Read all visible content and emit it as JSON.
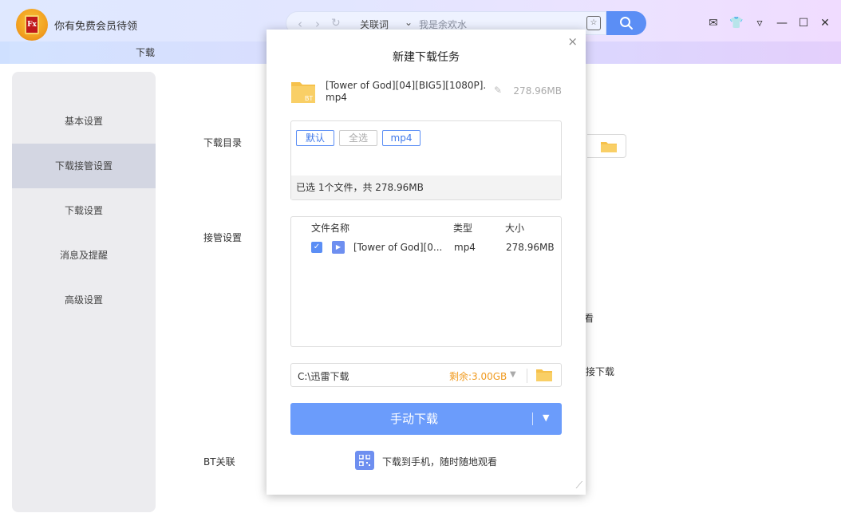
{
  "app": {
    "vip_text": "你有免费会员待领",
    "logo_text": "Fx",
    "tab_label": "下载"
  },
  "search": {
    "assoc_label": "关联词",
    "placeholder": "我是余欢水"
  },
  "sidebar": {
    "items": [
      {
        "label": "基本设置"
      },
      {
        "label": "下载接管设置"
      },
      {
        "label": "下载设置"
      },
      {
        "label": "消息及提醒"
      },
      {
        "label": "高级设置"
      }
    ]
  },
  "settings": {
    "download_dir_label": "下载目录",
    "takeover_label": "接管设置",
    "bt_label": "BT关联",
    "frag_1": "看",
    "frag_2": "接下载"
  },
  "dialog": {
    "title": "新建下载任务",
    "file_name": "[Tower of God][04][BIG5][1080P].mp4",
    "file_size": "278.96MB",
    "bt_badge": "BT",
    "filters": [
      {
        "label": "默认",
        "active": true
      },
      {
        "label": "全选",
        "active": false
      },
      {
        "label": "mp4",
        "active": true
      }
    ],
    "selection_summary": "已选 1个文件，共 278.96MB",
    "table": {
      "headers": [
        "文件名称",
        "类型",
        "大小"
      ],
      "rows": [
        {
          "name": "[Tower of God][0...",
          "type": "mp4",
          "size": "278.96MB",
          "checked": true
        }
      ]
    },
    "path": "C:\\迅雷下载",
    "free_space": "剩余:3.00GB",
    "download_button": "手动下载",
    "phone_text": "下载到手机，随时随地观看"
  },
  "colors": {
    "accent": "#5b8ef5",
    "button": "#6b9cfb",
    "free_space": "#f09a1e"
  }
}
